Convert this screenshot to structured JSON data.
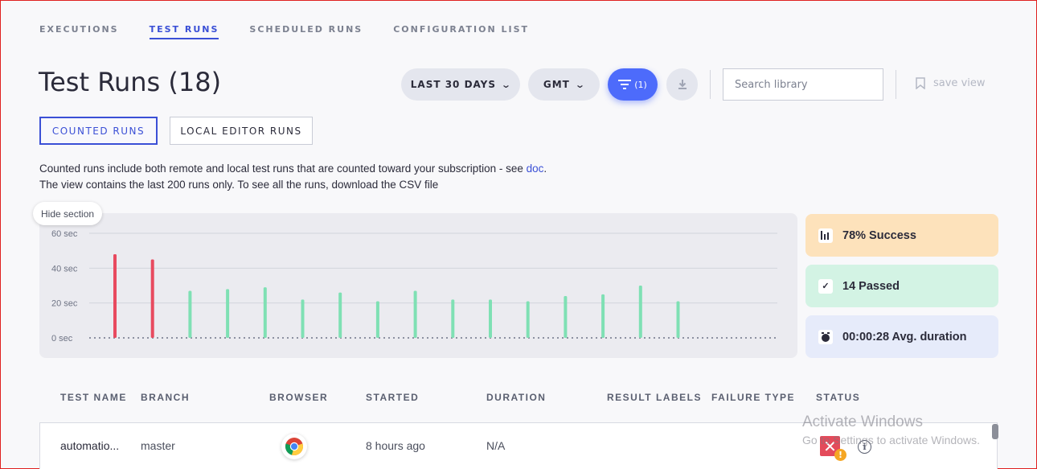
{
  "nav": {
    "tabs": [
      {
        "label": "EXECUTIONS",
        "active": false
      },
      {
        "label": "TEST RUNS",
        "active": true
      },
      {
        "label": "SCHEDULED RUNS",
        "active": false
      },
      {
        "label": "CONFIGURATION LIST",
        "active": false
      }
    ]
  },
  "page": {
    "title": "Test Runs (18)"
  },
  "toolbar": {
    "date_range": "LAST 30 DAYS",
    "timezone": "GMT",
    "filter_count": "(1)",
    "search_placeholder": "Search library",
    "save_view": "save view"
  },
  "run_types": {
    "counted": "COUNTED RUNS",
    "local": "LOCAL EDITOR RUNS"
  },
  "info": {
    "line1_prefix": "Counted runs include both remote and local test runs that are counted toward your subscription - see ",
    "line1_link": "doc",
    "line1_suffix": ".",
    "line2": "The view contains the last 200 runs only. To see all the runs, download the CSV file"
  },
  "hide_section": "Hide section",
  "chart_data": {
    "type": "bar",
    "ylabel": "",
    "ylim": [
      0,
      60
    ],
    "ytick_labels": [
      "0 sec",
      "20 sec",
      "40 sec",
      "60 sec"
    ],
    "yticks": [
      0,
      20,
      40,
      60
    ],
    "values": [
      48,
      45,
      27,
      28,
      29,
      22,
      26,
      21,
      27,
      22,
      22,
      21,
      24,
      25,
      30,
      21
    ],
    "status": [
      "failed",
      "failed",
      "passed",
      "passed",
      "passed",
      "passed",
      "passed",
      "passed",
      "passed",
      "passed",
      "passed",
      "passed",
      "passed",
      "passed",
      "passed",
      "passed"
    ],
    "colors": {
      "failed": "#e84a5f",
      "passed": "#7fe0b4"
    },
    "grid": true
  },
  "stats": {
    "success": "78% Success",
    "passed": "14 Passed",
    "duration": "00:00:28 Avg. duration"
  },
  "table": {
    "columns": [
      "TEST NAME",
      "BRANCH",
      "BROWSER",
      "STARTED",
      "DURATION",
      "RESULT LABELS",
      "FAILURE TYPE",
      "STATUS"
    ],
    "rows": [
      {
        "name": "automatio...",
        "branch": "master",
        "browser": "chrome-icon",
        "started": "8 hours ago",
        "duration": "N/A",
        "status": "failed"
      }
    ]
  },
  "watermark": {
    "line1": "Activate Windows",
    "line2": "Go to Settings to activate Windows."
  }
}
